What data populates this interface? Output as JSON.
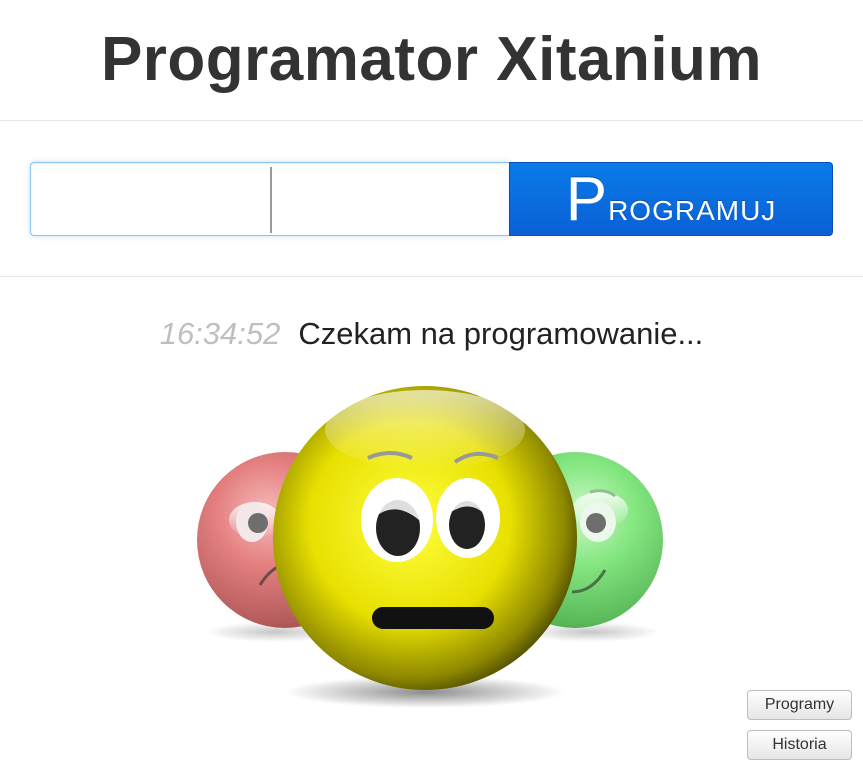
{
  "header": {
    "title": "Programator Xitanium"
  },
  "form": {
    "input1_value": "",
    "input2_value": "",
    "button_label_first": "P",
    "button_label_rest": "rogramuj"
  },
  "status": {
    "time": "16:34:52",
    "message": "Czekam na programowanie..."
  },
  "smileys": {
    "left": {
      "color": "#d94b4b",
      "mood": "sad",
      "icon": "red-sad-smiley-icon"
    },
    "center": {
      "color": "#e6e000",
      "mood": "neutral",
      "icon": "yellow-neutral-smiley-icon"
    },
    "right": {
      "color": "#4fdc4f",
      "mood": "happy",
      "icon": "green-happy-smiley-icon"
    }
  },
  "side_buttons": {
    "programy": "Programy",
    "historia": "Historia"
  },
  "colors": {
    "accent": "#0a6bde",
    "title": "#333333",
    "time": "#bfbfbf"
  }
}
